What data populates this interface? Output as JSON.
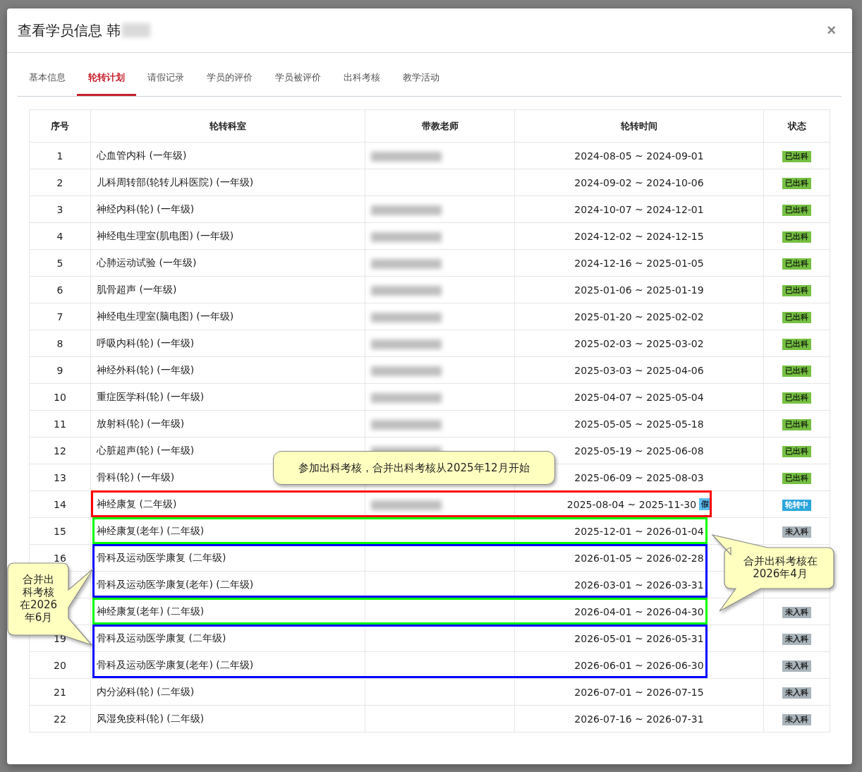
{
  "modal": {
    "title": "查看学员信息 韩",
    "title_blurred": true,
    "close": "×"
  },
  "tabs": [
    {
      "label": "基本信息",
      "selected": false
    },
    {
      "label": "轮转计划",
      "selected": true
    },
    {
      "label": "请假记录",
      "selected": false
    },
    {
      "label": "学员的评价",
      "selected": false
    },
    {
      "label": "学员被评价",
      "selected": false
    },
    {
      "label": "出科考核",
      "selected": false
    },
    {
      "label": "教学活动",
      "selected": false
    }
  ],
  "table": {
    "columns": [
      "序号",
      "轮转科室",
      "带教老师",
      "轮转时间",
      "状态"
    ],
    "rows": [
      {
        "no": "1",
        "dept": "心血管内科 (一年级)",
        "teacher_blurred": true,
        "time": "2024-08-05 ~ 2024-09-01",
        "status": {
          "text": "已出科",
          "kind": "done"
        }
      },
      {
        "no": "2",
        "dept": "儿科周转部(轮转儿科医院) (一年级)",
        "teacher_blurred": false,
        "time": "2024-09-02 ~ 2024-10-06",
        "status": {
          "text": "已出科",
          "kind": "done"
        }
      },
      {
        "no": "3",
        "dept": "神经内科(轮) (一年级)",
        "teacher_blurred": true,
        "time": "2024-10-07 ~ 2024-12-01",
        "status": {
          "text": "已出科",
          "kind": "done"
        }
      },
      {
        "no": "4",
        "dept": "神经电生理室(肌电图) (一年级)",
        "teacher_blurred": true,
        "time": "2024-12-02 ~ 2024-12-15",
        "status": {
          "text": "已出科",
          "kind": "done"
        }
      },
      {
        "no": "5",
        "dept": "心肺运动试验 (一年级)",
        "teacher_blurred": true,
        "time": "2024-12-16 ~ 2025-01-05",
        "status": {
          "text": "已出科",
          "kind": "done"
        }
      },
      {
        "no": "6",
        "dept": "肌骨超声 (一年级)",
        "teacher_blurred": true,
        "time": "2025-01-06 ~ 2025-01-19",
        "status": {
          "text": "已出科",
          "kind": "done"
        }
      },
      {
        "no": "7",
        "dept": "神经电生理室(脑电图) (一年级)",
        "teacher_blurred": true,
        "time": "2025-01-20 ~ 2025-02-02",
        "status": {
          "text": "已出科",
          "kind": "done"
        }
      },
      {
        "no": "8",
        "dept": "呼吸内科(轮) (一年级)",
        "teacher_blurred": true,
        "time": "2025-02-03 ~ 2025-03-02",
        "status": {
          "text": "已出科",
          "kind": "done"
        }
      },
      {
        "no": "9",
        "dept": "神经外科(轮) (一年级)",
        "teacher_blurred": true,
        "time": "2025-03-03 ~ 2025-04-06",
        "status": {
          "text": "已出科",
          "kind": "done"
        }
      },
      {
        "no": "10",
        "dept": "重症医学科(轮) (一年级)",
        "teacher_blurred": true,
        "time": "2025-04-07 ~ 2025-05-04",
        "status": {
          "text": "已出科",
          "kind": "done"
        }
      },
      {
        "no": "11",
        "dept": "放射科(轮) (一年级)",
        "teacher_blurred": true,
        "time": "2025-05-05 ~ 2025-05-18",
        "status": {
          "text": "已出科",
          "kind": "done"
        }
      },
      {
        "no": "12",
        "dept": "心脏超声(轮) (一年级)",
        "teacher_blurred": true,
        "time": "2025-05-19 ~ 2025-06-08",
        "status": {
          "text": "已出科",
          "kind": "done"
        }
      },
      {
        "no": "13",
        "dept": "骨科(轮) (一年级)",
        "teacher_blurred": false,
        "time": "2025-06-09 ~ 2025-08-03",
        "status": {
          "text": "已出科",
          "kind": "done"
        }
      },
      {
        "no": "14",
        "dept": "神经康复 (二年级)",
        "teacher_blurred": true,
        "time": "2025-08-04 ~ 2025-11-30",
        "color": "#ff0000",
        "leave": "假",
        "status": {
          "text": "轮转中",
          "kind": "current"
        }
      },
      {
        "no": "15",
        "dept": "神经康复(老年) (二年级)",
        "teacher_blurred": false,
        "time": "2025-12-01 ~ 2026-01-04",
        "color": "#00ff00",
        "status": {
          "text": "未入科",
          "kind": "pending"
        }
      },
      {
        "no": "16",
        "dept": "骨科及运动医学康复 (二年级)",
        "teacher_blurred": false,
        "time": "2026-01-05 ~ 2026-02-28",
        "color": "#0000ff"
      },
      {
        "dept": "骨科及运动医学康复(老年) (二年级)",
        "teacher_blurred": false,
        "time": "2026-03-01 ~ 2026-03-31",
        "color": "#0000ff"
      },
      {
        "dept": "神经康复(老年) (二年级)",
        "teacher_blurred": false,
        "time": "2026-04-01 ~ 2026-04-30",
        "color": "#00ff00",
        "status": {
          "text": "未入科",
          "kind": "pending"
        }
      },
      {
        "no": "19",
        "dept": "骨科及运动医学康复 (二年级)",
        "teacher_blurred": false,
        "time": "2026-05-01 ~ 2026-05-31",
        "color": "#0000ff",
        "status": {
          "text": "未入科",
          "kind": "pending"
        }
      },
      {
        "no": "20",
        "dept": "骨科及运动医学康复(老年) (二年级)",
        "teacher_blurred": false,
        "time": "2026-06-01 ~ 2026-06-30",
        "color": "#0000ff",
        "status": {
          "text": "未入科",
          "kind": "pending"
        }
      },
      {
        "no": "21",
        "dept": "内分泌科(轮) (二年级)",
        "teacher_blurred": false,
        "time": "2026-07-01 ~ 2026-07-15",
        "status": {
          "text": "未入科",
          "kind": "pending"
        }
      },
      {
        "no": "22",
        "dept": "风湿免疫科(轮) (二年级)",
        "teacher_blurred": false,
        "time": "2026-07-16 ~ 2026-07-31",
        "status": {
          "text": "未入科",
          "kind": "pending"
        }
      }
    ]
  },
  "callouts": [
    {
      "text": "参加出科考核，合并出科考核从2025年12月开始"
    },
    {
      "text": "合并出科考核在2026年4月"
    },
    {
      "text": "合并出科考核在2026年6月"
    }
  ]
}
